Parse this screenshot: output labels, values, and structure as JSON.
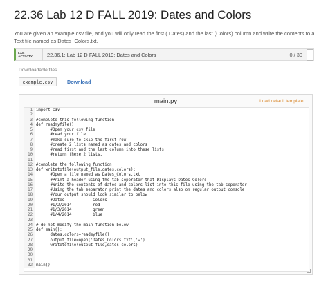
{
  "page": {
    "title": "22.36 Lab 12 D FALL 2019: Dates and Colors",
    "instructions": "You are given an example.csv file, and you will only read the first ( Dates) and the last (Colors) column and write the contents to a Text file named as Dates_Colors.txt."
  },
  "lab": {
    "badge": "LAB\nACTIVITY",
    "name": "22.36.1: Lab 12 D FALL 2019: Dates and Colors",
    "score": "0 / 30"
  },
  "files": {
    "label": "Downloadable files",
    "file_name": "example.csv",
    "download_label": "Download"
  },
  "editor": {
    "file_name": "main.py",
    "load_template_label": "Load default template...",
    "lines": [
      {
        "n": "1",
        "text": "import csv"
      },
      {
        "n": "2",
        "text": ""
      },
      {
        "n": "3",
        "text": "#complete this following function"
      },
      {
        "n": "4",
        "text": "def readmyfile():"
      },
      {
        "n": "5",
        "text": "      #Open your csv file"
      },
      {
        "n": "6",
        "text": "      #read your file"
      },
      {
        "n": "7",
        "text": "      #make sure to skip the first row"
      },
      {
        "n": "8",
        "text": "      #create 2 lists named as dates and colors"
      },
      {
        "n": "9",
        "text": "      #read first and the last column into these lists."
      },
      {
        "n": "10",
        "text": "      #return these 2 lists."
      },
      {
        "n": "11",
        "text": ""
      },
      {
        "n": "12",
        "text": "#complete the following function"
      },
      {
        "n": "13",
        "text": "def writetofile(output_file,dates,colors):"
      },
      {
        "n": "14",
        "text": "      #Open a file named as Dates_Colors.txt"
      },
      {
        "n": "15",
        "text": "      #Print a header using the tab seperator that Displays Dates Colors"
      },
      {
        "n": "16",
        "text": "      #Write the contents of dates and colors list into this file using the tab seperator."
      },
      {
        "n": "17",
        "text": "      #Using the tab separator print the dates and colors also on regular output console"
      },
      {
        "n": "18",
        "text": "      #Your output should look similar to below"
      },
      {
        "n": "19",
        "text": "      #Dates            Colors"
      },
      {
        "n": "20",
        "text": "      #1/2/2014         red"
      },
      {
        "n": "21",
        "text": "      #1/3/2014         green"
      },
      {
        "n": "22",
        "text": "      #1/4/2014         blue"
      },
      {
        "n": "23",
        "text": ""
      },
      {
        "n": "24",
        "text": "# do not modify the main function below"
      },
      {
        "n": "25",
        "text": "def main():"
      },
      {
        "n": "26",
        "text": "      dates,colors=readmyfile()"
      },
      {
        "n": "27",
        "text": "      output_file=open('Dates_Colors.txt','w')"
      },
      {
        "n": "28",
        "text": "      writetofile(output_file,dates,colors)"
      },
      {
        "n": "29",
        "text": ""
      },
      {
        "n": "30",
        "text": ""
      },
      {
        "n": "31",
        "text": ""
      },
      {
        "n": "32",
        "text": "main()"
      }
    ]
  },
  "colors": {
    "accent_green": "#6ba84f",
    "link_blue": "#3b73b9",
    "template_orange": "#d98a31"
  },
  "icons": {
    "resize": "resize-grip-icon"
  }
}
